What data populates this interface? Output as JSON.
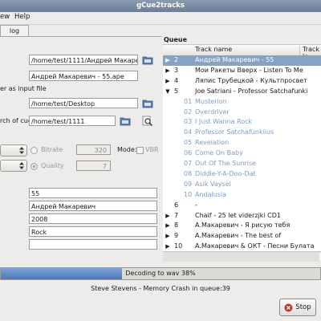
{
  "window": {
    "title": "gCue2tracks"
  },
  "menu": {
    "items": [
      "ew",
      "Help"
    ]
  },
  "tabs": {
    "active": "log"
  },
  "form": {
    "cue_path": "/home/test/1111/Андрей Макаревич",
    "image_file": "Андрей Макаревич - 55.ape",
    "output_label": "er as input file",
    "output_dir": "/home/test/Desktop",
    "search_label": "rch of cue",
    "search_dir": "/home/test/1111",
    "bitrate_label": "Bitrate",
    "bitrate_value": "320",
    "mode_label": "Mode:",
    "vbr_label": "VBR",
    "quality_label": "Quality",
    "quality_value": "7",
    "album": "55",
    "artist": "Андрей Макаревич",
    "year": "2008",
    "genre": "Rock",
    "comment": ""
  },
  "queue": {
    "title": "Queue",
    "col_track": "Track name",
    "col_track_len": "Track le",
    "rows": [
      {
        "exp": "▶",
        "num": "2",
        "name": "Андрей Макаревич - 55",
        "sel": true,
        "child": false
      },
      {
        "exp": "▶",
        "num": "3",
        "name": "Мои Ракеты Вверх - Listen To Me",
        "sel": false,
        "child": false
      },
      {
        "exp": "▶",
        "num": "4",
        "name": "Ляпис Трубецкой - Культпросвет",
        "sel": false,
        "child": false
      },
      {
        "exp": "▼",
        "num": "5",
        "name": "Joe Satriani - Professor Satchafunki",
        "sel": false,
        "child": false
      },
      {
        "exp": "",
        "num": "01",
        "name": "Musterion",
        "sel": false,
        "child": true
      },
      {
        "exp": "",
        "num": "02",
        "name": "Overdriver",
        "sel": false,
        "child": true
      },
      {
        "exp": "",
        "num": "03",
        "name": "I Just Wanna Rock",
        "sel": false,
        "child": true
      },
      {
        "exp": "",
        "num": "04",
        "name": "Professor Satchafunkilus",
        "sel": false,
        "child": true
      },
      {
        "exp": "",
        "num": "05",
        "name": "Revelation",
        "sel": false,
        "child": true
      },
      {
        "exp": "",
        "num": "06",
        "name": "Come On Baby",
        "sel": false,
        "child": true
      },
      {
        "exp": "",
        "num": "07",
        "name": "Out Of The Sunrise",
        "sel": false,
        "child": true
      },
      {
        "exp": "",
        "num": "08",
        "name": "Diddle-Y-A-Doo-Dat",
        "sel": false,
        "child": true
      },
      {
        "exp": "",
        "num": "09",
        "name": "Asik Vaysel",
        "sel": false,
        "child": true
      },
      {
        "exp": "",
        "num": "10",
        "name": "Andalusia",
        "sel": false,
        "child": true
      },
      {
        "exp": "",
        "num": "6",
        "name": "-",
        "sel": false,
        "child": false
      },
      {
        "exp": "▶",
        "num": "7",
        "name": "Chaif - 25 let viderzjki CD1",
        "sel": false,
        "child": false
      },
      {
        "exp": "▶",
        "num": "8",
        "name": "А.Макаревич - Я рисую тебя",
        "sel": false,
        "child": false
      },
      {
        "exp": "▶",
        "num": "9",
        "name": "А.Макаревич - The best of",
        "sel": false,
        "child": false
      },
      {
        "exp": "▶",
        "num": "10",
        "name": "А.Макаревич & ОКТ - Песни Булата",
        "sel": false,
        "child": false
      }
    ]
  },
  "progress": {
    "text": "Decoding to wav 38%",
    "fraction": 0.38
  },
  "status": {
    "text": "Steve Stevens - Memory Crash   in queue:39"
  },
  "buttons": {
    "stop": "Stop"
  },
  "colors": {
    "selection": "#86a3c6",
    "child_text": "#7f9cbf",
    "progress": "#4a78b8",
    "titlebar": "#6c7d96"
  }
}
